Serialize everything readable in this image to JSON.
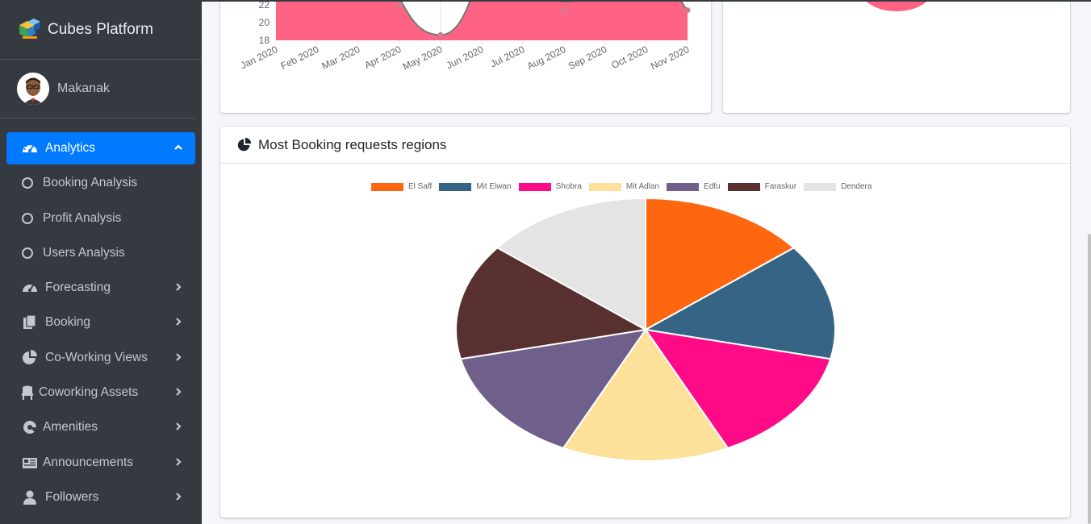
{
  "app": {
    "brand": "Cubes Platform"
  },
  "user": {
    "name": "Makanak"
  },
  "sidebar": {
    "items": [
      {
        "label": "Analytics",
        "icon": "tachometer-icon",
        "active": true,
        "expanded": true
      },
      {
        "label": "Booking Analysis",
        "icon": "circle-icon",
        "sub": true
      },
      {
        "label": "Profit Analysis",
        "icon": "circle-icon",
        "sub": true
      },
      {
        "label": "Users Analysis",
        "icon": "circle-icon",
        "sub": true
      },
      {
        "label": "Forecasting",
        "icon": "tachometer-icon"
      },
      {
        "label": "Booking",
        "icon": "copy-icon"
      },
      {
        "label": "Co-Working Views",
        "icon": "pie-chart-icon"
      },
      {
        "label": "Coworking Assets",
        "icon": "chair-icon"
      },
      {
        "label": "Amenities",
        "icon": "amenity-icon"
      },
      {
        "label": "Announcements",
        "icon": "newspaper-icon"
      },
      {
        "label": "Followers",
        "icon": "user-icon"
      }
    ]
  },
  "regions_card": {
    "title": "Most Booking requests regions"
  },
  "chart_data": [
    {
      "type": "area",
      "x_ticks": [
        "Jan 2020",
        "Feb 2020",
        "Mar 2020",
        "Apr 2020",
        "May 2020",
        "Jun 2020",
        "Jul 2020",
        "Aug 2020",
        "Sep 2020",
        "Oct 2020",
        "Nov 2020"
      ],
      "y_ticks": [
        18,
        20,
        22
      ],
      "visible_points": [
        {
          "x": "Apr 2020",
          "y": 22
        },
        {
          "x": "May 2020",
          "y": 18.6
        },
        {
          "x": "Aug 2020",
          "y": 21.4
        },
        {
          "x": "Nov 2020",
          "y": 21.4
        }
      ],
      "color": "#ff6384"
    },
    {
      "type": "pie",
      "labels": [
        "El Saff",
        "Mit Elwan",
        "Shobra",
        "Mit Adlan",
        "Edfu",
        "Faraskur",
        "Dendera"
      ],
      "values": [
        1,
        1,
        1,
        1,
        1,
        1,
        1
      ],
      "colors": [
        "#ff6610",
        "#356485",
        "#ff0a87",
        "#fde19a",
        "#6e608b",
        "#57302f",
        "#e4e4e4"
      ]
    }
  ]
}
